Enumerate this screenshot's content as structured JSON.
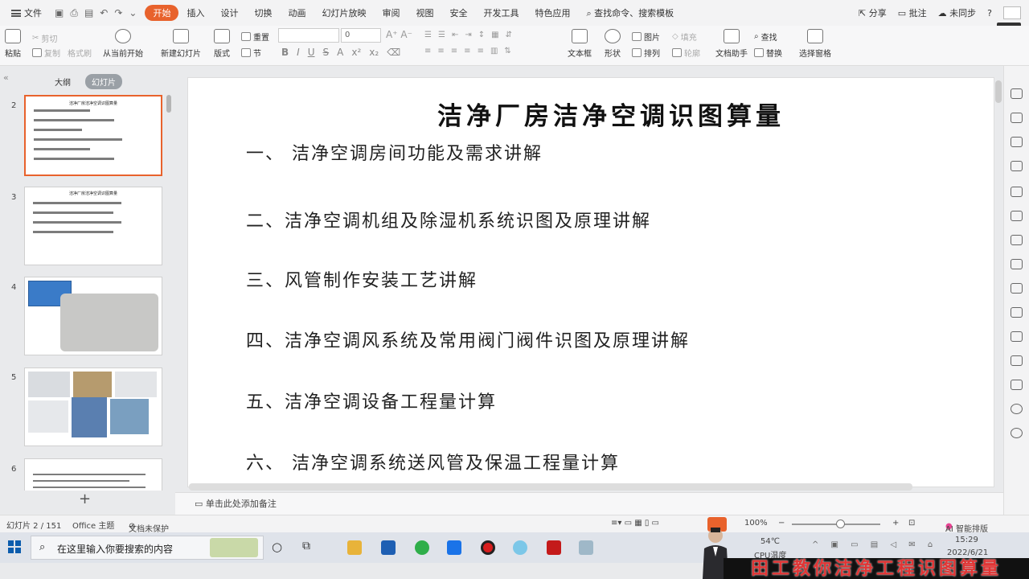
{
  "menubar": {
    "file_label": "文件",
    "tabs": [
      "开始",
      "插入",
      "设计",
      "切换",
      "动画",
      "幻灯片放映",
      "审阅",
      "视图",
      "安全",
      "开发工具",
      "特色应用"
    ],
    "active_tab": "开始",
    "search_label": "查找命令、搜索模板",
    "share_label": "分享",
    "comment_label": "批注",
    "sync_label": "未同步",
    "tooltip": "开始"
  },
  "ribbon": {
    "paste": "粘贴",
    "cut": "剪切",
    "copy": "复制",
    "format_painter": "格式刷",
    "from_current": "从当前开始",
    "new_slide": "新建幻灯片",
    "layout": "版式",
    "reset": "重置",
    "section": "节",
    "font_size": "0",
    "textbox": "文本框",
    "shape": "形状",
    "picture": "图片",
    "fill": "填充",
    "arrange": "排列",
    "outline": "轮廓",
    "find": "查找",
    "replace": "替换",
    "doc_assistant": "文档助手",
    "select_pane": "选择窗格"
  },
  "leftpane": {
    "tab_outline": "大纲",
    "tab_slides": "幻灯片",
    "slide_numbers": [
      "2",
      "3",
      "4",
      "5",
      "6"
    ],
    "thumb2_title": "洁净厂房洁净空调识图算量",
    "thumb3_title": "洁净厂房洁净空调识图算量"
  },
  "slide": {
    "title": "洁净厂房洁净空调识图算量",
    "lines": [
      "一、 洁净空调房间功能及需求讲解",
      "二、洁净空调机组及除湿机系统识图及原理讲解",
      "三、风管制作安装工艺讲解",
      "四、洁净空调风系统及常用阀门阀件识图及原理讲解",
      "五、洁净空调设备工程量计算",
      "六、 洁净空调系统送风管及保温工程量计算"
    ]
  },
  "notes_placeholder": "单击此处添加备注",
  "status": {
    "slide_count": "幻灯片 2 / 151",
    "theme": "Office 主题",
    "protect": "文档未保护",
    "zoom": "100%",
    "ai": "AI 智能排版"
  },
  "taskbar": {
    "search_placeholder": "在这里输入你要搜索的内容",
    "temp": "54℃",
    "cpu": "CPU温度",
    "time": "15:29",
    "date": "2022/6/21"
  },
  "watermark": "田工教你洁净工程识图算量"
}
